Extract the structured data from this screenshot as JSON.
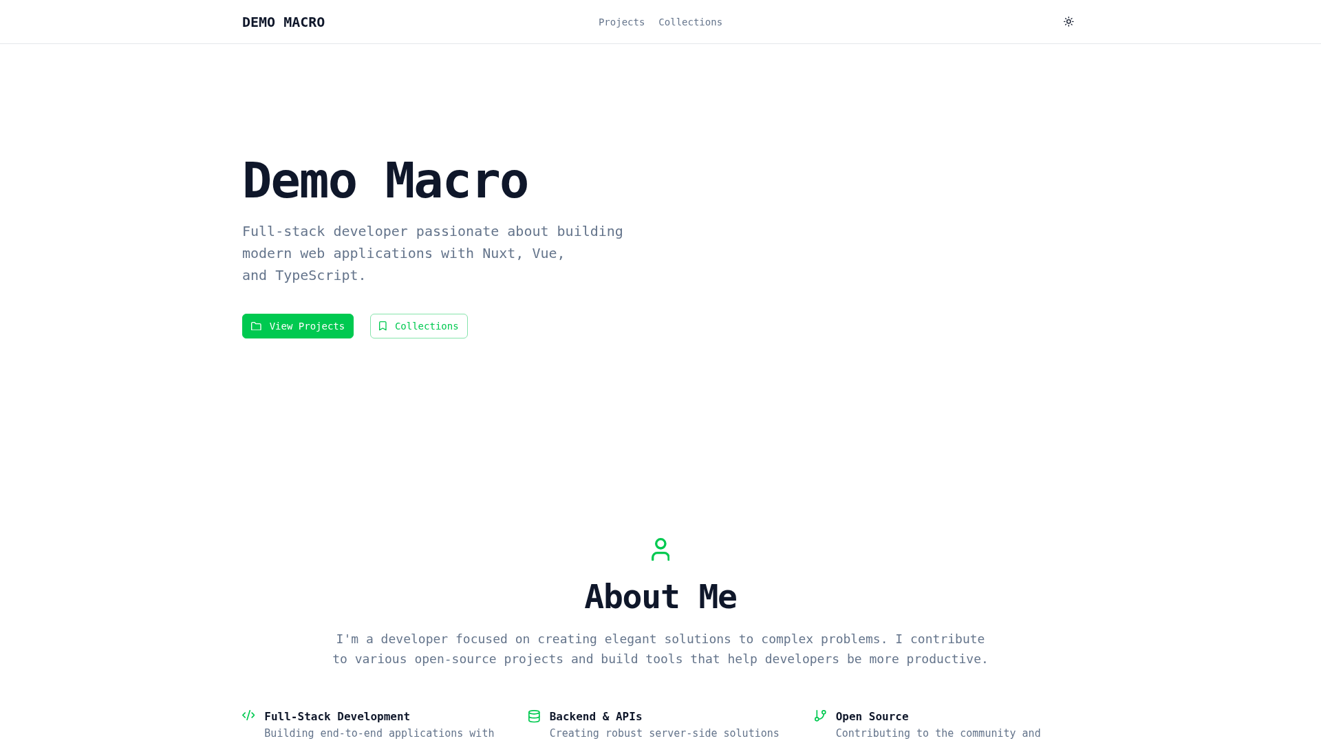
{
  "header": {
    "logo": "DEMO MACRO",
    "nav": [
      {
        "label": "Projects"
      },
      {
        "label": "Collections"
      }
    ]
  },
  "hero": {
    "title": "Demo Macro",
    "subtitle": "Full-stack developer passionate about building\nmodern web applications with Nuxt, Vue,\nand TypeScript.",
    "buttons": [
      {
        "label": "View Projects",
        "kind": "primary"
      },
      {
        "label": "Collections",
        "kind": "outline"
      }
    ]
  },
  "about": {
    "title": "About Me",
    "text": "I'm a developer focused on creating elegant solutions to complex problems. I contribute to various open-source projects and build tools that help developers be more productive.",
    "features": [
      {
        "title": "Full-Stack Development",
        "description": "Building end-to-end applications with"
      },
      {
        "title": "Backend & APIs",
        "description": "Creating robust server-side solutions"
      },
      {
        "title": "Open Source",
        "description": "Contributing to the community and"
      }
    ]
  }
}
